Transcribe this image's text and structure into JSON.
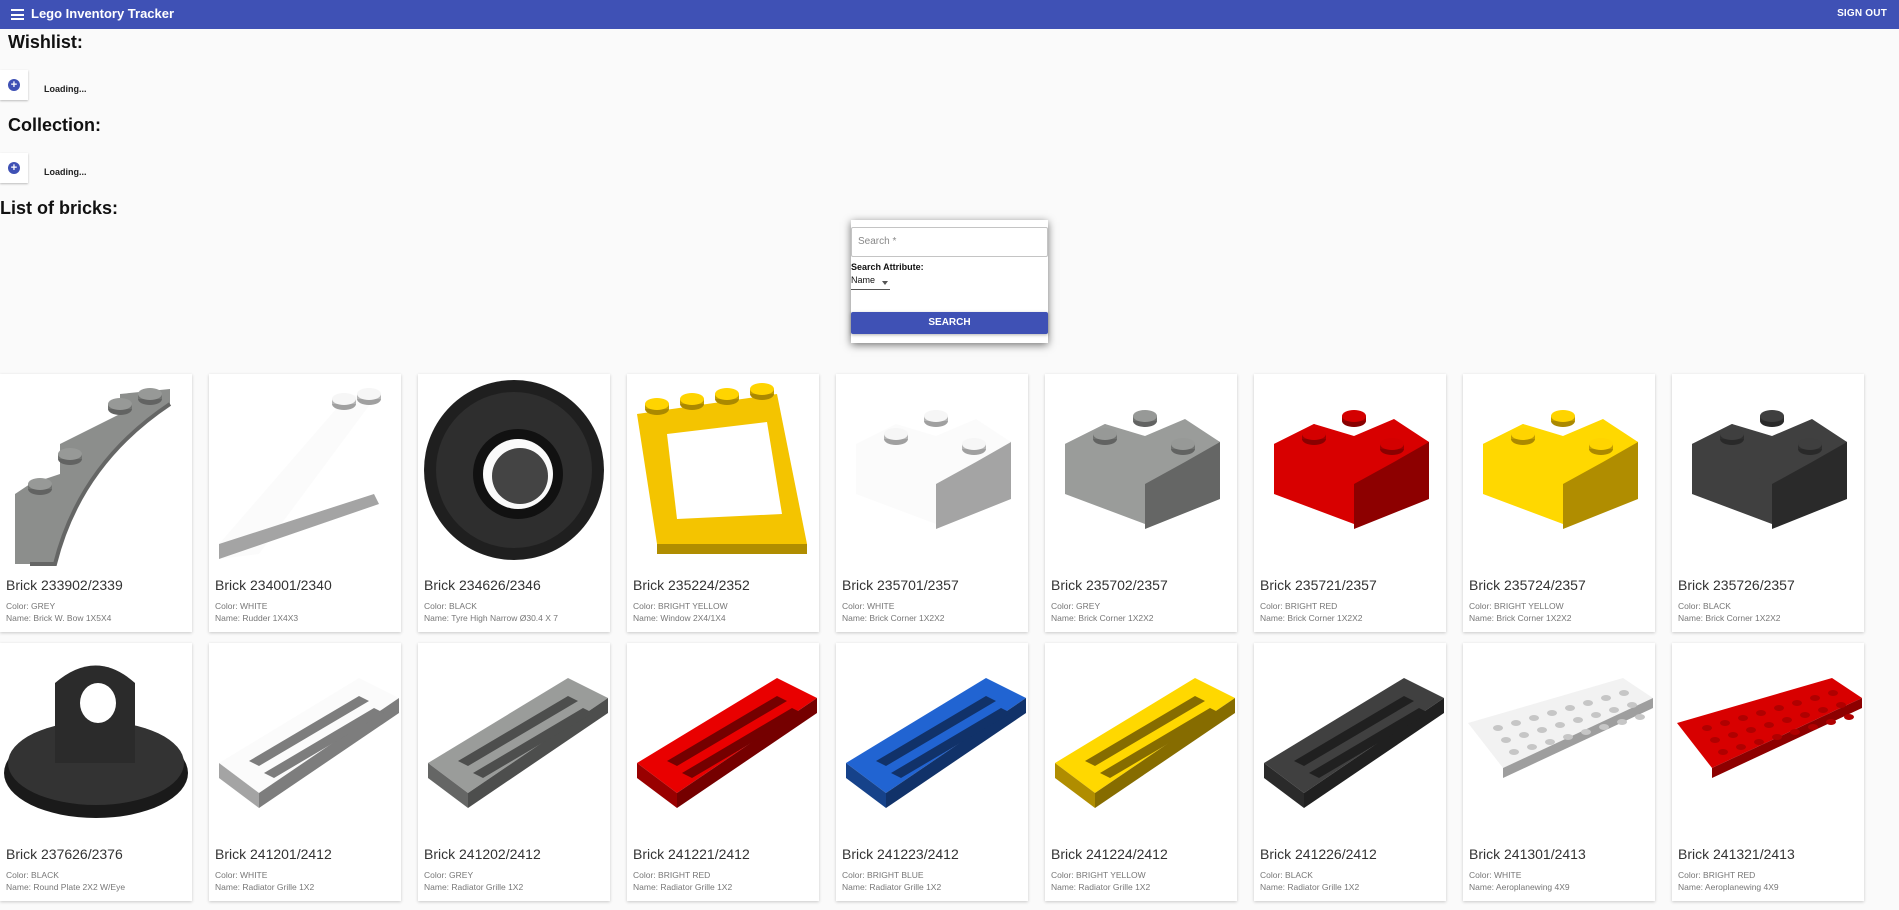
{
  "appbar": {
    "title": "Lego Inventory Tracker",
    "signout_label": "SIGN OUT"
  },
  "wishlist": {
    "heading": "Wishlist:",
    "status": "Loading..."
  },
  "collection": {
    "heading": "Collection:",
    "status": "Loading..."
  },
  "bricks_section": {
    "heading": "List of bricks:"
  },
  "search": {
    "placeholder": "Search *",
    "attribute_label": "Search Attribute:",
    "attribute_value": "Name",
    "button_label": "SEARCH"
  },
  "colors": {
    "accent": "#3f51b5"
  },
  "bricks": [
    {
      "title": "Brick 233902/2339",
      "color_text": "Color: GREY",
      "name_text": "Name: Brick W. Bow 1X5X4",
      "icon": "arch-brick",
      "swatch": "#8c8e8c"
    },
    {
      "title": "Brick 234001/2340",
      "color_text": "Color: WHITE",
      "name_text": "Name: Rudder 1X4X3",
      "icon": "rudder-brick",
      "swatch": "#e4e4e4"
    },
    {
      "title": "Brick 234626/2346",
      "color_text": "Color: BLACK",
      "name_text": "Name: Tyre High Narrow Ø30.4 X 7",
      "icon": "tyre",
      "swatch": "#2a2a2a"
    },
    {
      "title": "Brick 235224/2352",
      "color_text": "Color: BRIGHT YELLOW",
      "name_text": "Name: Window 2X4/1X4",
      "icon": "window-brick",
      "swatch": "#f4c400"
    },
    {
      "title": "Brick 235701/2357",
      "color_text": "Color: WHITE",
      "name_text": "Name: Brick Corner 1X2X2",
      "icon": "corner-brick",
      "swatch": "#e4e4e4"
    },
    {
      "title": "Brick 235702/2357",
      "color_text": "Color: GREY",
      "name_text": "Name: Brick Corner 1X2X2",
      "icon": "corner-brick",
      "swatch": "#8c8e8c"
    },
    {
      "title": "Brick 235721/2357",
      "color_text": "Color: BRIGHT RED",
      "name_text": "Name: Brick Corner 1X2X2",
      "icon": "corner-brick",
      "swatch": "#c40000"
    },
    {
      "title": "Brick 235724/2357",
      "color_text": "Color: BRIGHT YELLOW",
      "name_text": "Name: Brick Corner 1X2X2",
      "icon": "corner-brick",
      "swatch": "#f4c400"
    },
    {
      "title": "Brick 235726/2357",
      "color_text": "Color: BLACK",
      "name_text": "Name: Brick Corner 1X2X2",
      "icon": "corner-brick",
      "swatch": "#3a3a3a"
    },
    {
      "title": "Brick 237626/2376",
      "color_text": "Color: BLACK",
      "name_text": "Name: Round Plate 2X2 W/Eye",
      "icon": "round-plate-eye",
      "swatch": "#2a2a2a"
    },
    {
      "title": "Brick 241201/2412",
      "color_text": "Color: WHITE",
      "name_text": "Name: Radiator Grille 1X2",
      "icon": "grille",
      "swatch": "#e4e4e4"
    },
    {
      "title": "Brick 241202/2412",
      "color_text": "Color: GREY",
      "name_text": "Name: Radiator Grille 1X2",
      "icon": "grille",
      "swatch": "#8c8e8c"
    },
    {
      "title": "Brick 241221/2412",
      "color_text": "Color: BRIGHT RED",
      "name_text": "Name: Radiator Grille 1X2",
      "icon": "grille",
      "swatch": "#d40000"
    },
    {
      "title": "Brick 241223/2412",
      "color_text": "Color: BRIGHT BLUE",
      "name_text": "Name: Radiator Grille 1X2",
      "icon": "grille",
      "swatch": "#1e5bbf"
    },
    {
      "title": "Brick 241224/2412",
      "color_text": "Color: BRIGHT YELLOW",
      "name_text": "Name: Radiator Grille 1X2",
      "icon": "grille",
      "swatch": "#f4c400"
    },
    {
      "title": "Brick 241226/2412",
      "color_text": "Color: BLACK",
      "name_text": "Name: Radiator Grille 1X2",
      "icon": "grille",
      "swatch": "#3a3a3a"
    },
    {
      "title": "Brick 241301/2413",
      "color_text": "Color: WHITE",
      "name_text": "Name: Aeroplanewing 4X9",
      "icon": "wing-plate",
      "swatch": "#dcdcdc"
    },
    {
      "title": "Brick 241321/2413",
      "color_text": "Color: BRIGHT RED",
      "name_text": "Name: Aeroplanewing 4X9",
      "icon": "wing-plate",
      "swatch": "#c40000"
    }
  ]
}
